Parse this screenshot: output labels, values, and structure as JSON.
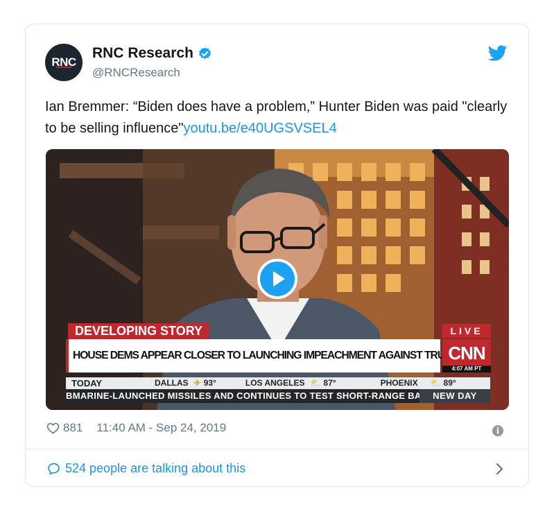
{
  "tweet": {
    "avatar_text": "RNC",
    "author_name": "RNC Research",
    "handle": "@RNCResearch",
    "body_text": "Ian Bremmer: “Biden does have a problem,” Hunter Biden was paid \"clearly to be selling influence\"",
    "body_link": "youtu.be/e40UGSVSEL4",
    "likes": "881",
    "timestamp": "11:40 AM - Sep 24, 2019",
    "talking": "524 people are talking about this"
  },
  "video": {
    "tag": "DEVELOPING STORY",
    "headline": "HOUSE DEMS APPEAR CLOSER TO LAUNCHING IMPEACHMENT AGAINST TRUMP",
    "live": "LIVE",
    "network": "CNN",
    "time": "4:07 AM PT",
    "weather_label": "TODAY",
    "weather": [
      {
        "city": "DALLAS",
        "temp": "93°"
      },
      {
        "city": "LOS ANGELES",
        "temp": "87°"
      },
      {
        "city": "PHOENIX",
        "temp": "89°"
      }
    ],
    "ticker": "BMARINE-LAUNCHED MISSILES AND CONTINUES TO TEST SHORT-RANGE BAL",
    "show": "NEW DAY"
  },
  "colors": {
    "link": "#1b95e0",
    "cnn_red": "#c0282d",
    "muted": "#657786"
  },
  "icons": [
    "verified-badge-icon",
    "twitter-bird-icon",
    "play-icon",
    "heart-icon",
    "info-icon",
    "comment-bubble-icon",
    "chevron-right-icon"
  ]
}
